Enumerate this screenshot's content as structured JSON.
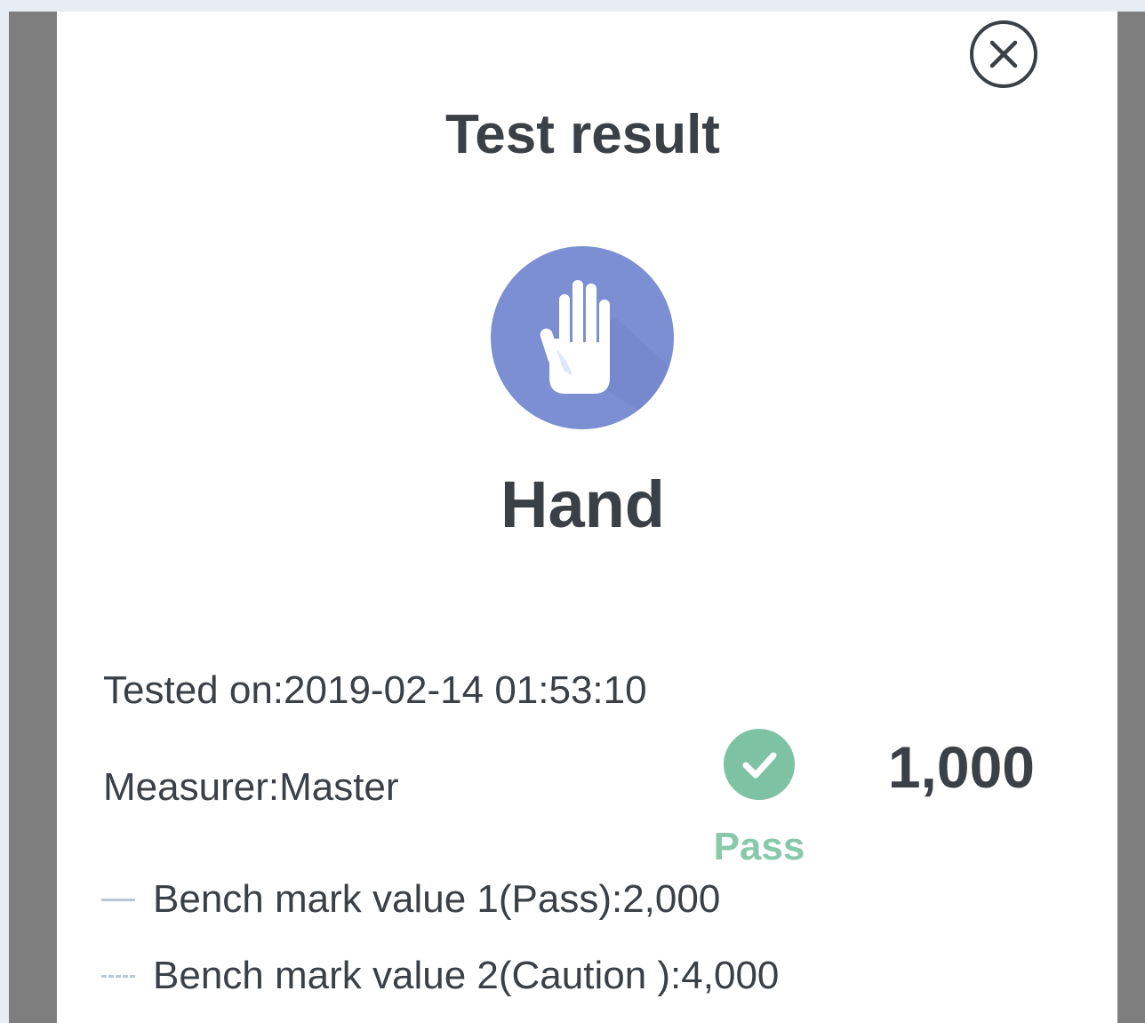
{
  "dialog": {
    "title": "Test result"
  },
  "result": {
    "body_part": "Hand",
    "tested_on": "Tested on:2019-02-14 01:53:10",
    "measurer": "Measurer:Master",
    "score": "1,000",
    "status": "Pass"
  },
  "benchmarks": [
    {
      "label": "Bench mark value 1(Pass):2,000",
      "line_style": "solid"
    },
    {
      "label": "Bench mark value 2(Caution ):4,000",
      "line_style": "dashed"
    }
  ],
  "icons": {
    "close": "close-icon",
    "body_part": "hand-icon",
    "status": "check-icon"
  },
  "colors": {
    "accent_purple": "#7c8fd3",
    "pass_green": "#7dc2a2",
    "text_dark": "#3a4045",
    "legend_line": "#b8c8d6"
  }
}
